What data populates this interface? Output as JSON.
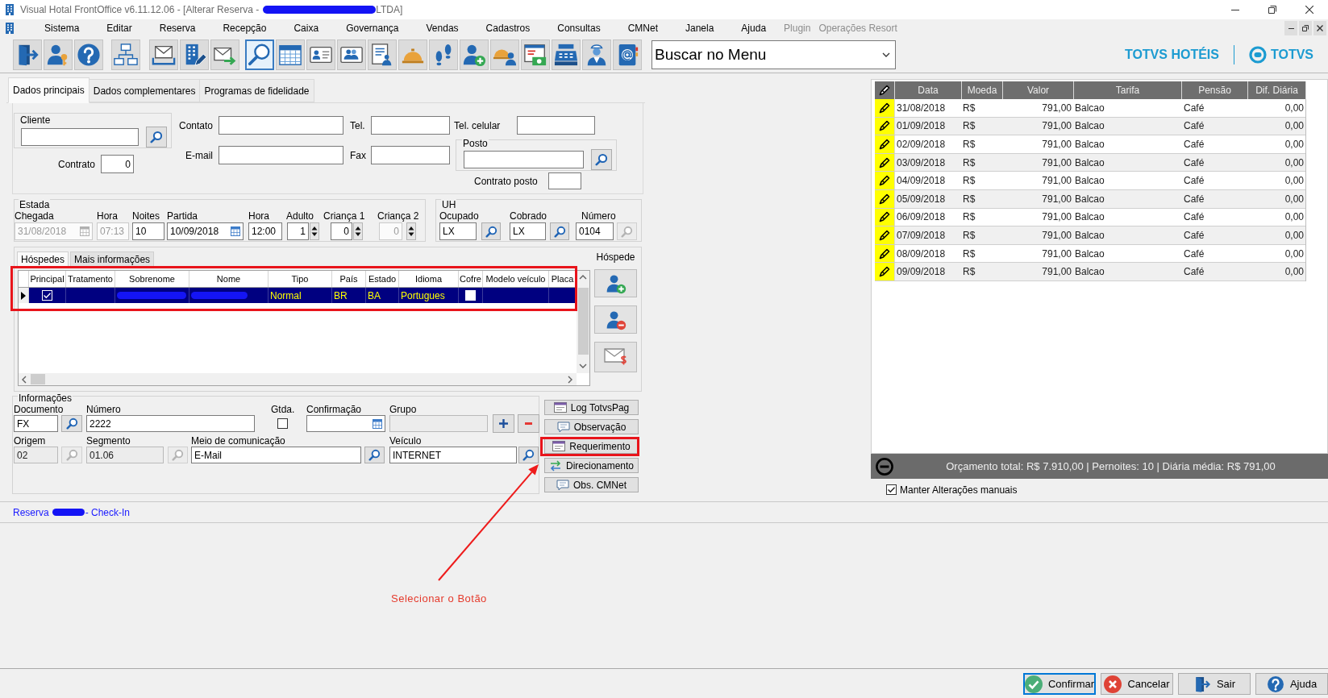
{
  "window": {
    "title_start": "Visual Hotal FrontOffice v6.11.12.06 - [Alterar Reserva -",
    "title_end": "LTDA]"
  },
  "menu": [
    {
      "label": "Sistema",
      "disabled": false
    },
    {
      "label": "Editar",
      "disabled": false
    },
    {
      "label": "Reserva",
      "disabled": false
    },
    {
      "label": "Recepção",
      "disabled": false
    },
    {
      "label": "Caixa",
      "disabled": false
    },
    {
      "label": "Governança",
      "disabled": false
    },
    {
      "label": "Vendas",
      "disabled": false
    },
    {
      "label": "Cadastros",
      "disabled": false
    },
    {
      "label": "Consultas",
      "disabled": false
    },
    {
      "label": "CMNet",
      "disabled": false
    },
    {
      "label": "Janela",
      "disabled": false
    },
    {
      "label": "Ajuda",
      "disabled": false
    },
    {
      "label": "Plugin",
      "disabled": true
    },
    {
      "label": "Operações Resort",
      "disabled": true
    }
  ],
  "toolbar": {
    "buttons": [
      {
        "selected": false
      },
      {
        "selected": false
      },
      {
        "selected": false
      },
      {
        "selected": false
      },
      {
        "selected": false
      },
      {
        "selected": false
      },
      {
        "selected": false
      },
      {
        "selected": true
      },
      {
        "selected": false
      },
      {
        "selected": false
      },
      {
        "selected": false
      },
      {
        "selected": false
      },
      {
        "selected": false
      },
      {
        "selected": false
      },
      {
        "selected": false
      },
      {
        "selected": false
      },
      {
        "selected": false
      },
      {
        "selected": false
      },
      {
        "selected": false
      },
      {
        "selected": false
      }
    ],
    "menu_search": {
      "value": "Buscar no Menu"
    },
    "brand": "TOTVS HOTÉIS",
    "logo_text": "TOTVS"
  },
  "tabs": [
    {
      "label": "Dados principais",
      "selected": true
    },
    {
      "label": "Dados complementares",
      "selected": false
    },
    {
      "label": "Programas de fidelidade",
      "selected": false
    }
  ],
  "client": {
    "legend": "Cliente"
  },
  "contract": {
    "label": "Contrato",
    "value": "0"
  },
  "contact_fields": [
    {
      "label": "Contato"
    },
    {
      "label": "E-mail"
    }
  ],
  "phone_fields": [
    {
      "label": "Tel."
    },
    {
      "label": "Fax"
    }
  ],
  "mobile": {
    "label": "Tel. celular"
  },
  "post": {
    "legend": "Posto"
  },
  "post_contract": {
    "label": "Contrato posto"
  },
  "stay": {
    "legend": "Estada",
    "fields": [
      {
        "label": "Chegada",
        "value": "31/08/2018",
        "kind": "date",
        "disabled": true
      },
      {
        "label": "Hora",
        "value": "07:13",
        "kind": "text",
        "disabled": true
      },
      {
        "label": "Noites",
        "value": "10",
        "kind": "text",
        "disabled": false
      },
      {
        "label": "Partida",
        "value": "10/09/2018",
        "kind": "date",
        "disabled": false
      },
      {
        "label": "Hora",
        "value": "12:00",
        "kind": "text",
        "disabled": false
      },
      {
        "label": "Adulto",
        "value": "1",
        "kind": "spin",
        "disabled": false
      },
      {
        "label": "Criança 1",
        "value": "0",
        "kind": "spin",
        "disabled": false
      },
      {
        "label": "Criança 2",
        "value": "0",
        "kind": "spin",
        "disabled": true
      }
    ]
  },
  "unit": {
    "legend": "UH",
    "fields": [
      {
        "label": "Ocupado",
        "value": "LX",
        "lookup_disabled": false
      },
      {
        "label": "Cobrado",
        "value": "LX",
        "lookup_disabled": false
      },
      {
        "label": "Número",
        "value": "0104",
        "lookup_disabled": true
      }
    ]
  },
  "guests": {
    "tabs": [
      {
        "label": "Hóspedes",
        "selected": true
      },
      {
        "label": "Mais informações",
        "selected": false
      }
    ],
    "side_label": "Hóspede",
    "highlighted": true,
    "columns": [
      "Principal",
      "Tratamento",
      "Sobrenome",
      "Nome",
      "Tipo",
      "País",
      "Estado",
      "Idioma",
      "Cofre",
      "Modelo veículo",
      "Placa"
    ],
    "rows": [
      {
        "selected": true,
        "principal": true,
        "type": "Normal",
        "country": "BR",
        "state": "BA",
        "language": "Portugues",
        "safe": false
      }
    ]
  },
  "info": {
    "legend": "Informações",
    "fields": [
      {
        "label": "Documento",
        "value": "FX",
        "kind": "lookup",
        "disabled": false
      },
      {
        "label": "Número",
        "value": "2222",
        "kind": "text",
        "disabled": false
      },
      {
        "label": "Gtda.",
        "kind": "checkbox",
        "checked": false
      },
      {
        "label": "Confirmação",
        "kind": "date",
        "disabled": false
      },
      {
        "label": "Grupo",
        "kind": "text",
        "disabled": true
      },
      {
        "label": "Origem",
        "value": "02",
        "kind": "lookup",
        "disabled": true
      },
      {
        "label": "Segmento",
        "value": "01.06",
        "kind": "lookup",
        "disabled": true
      },
      {
        "label": "Meio de comunicação",
        "value": "E-Mail",
        "kind": "lookup",
        "disabled": false
      },
      {
        "label": "Veículo",
        "value": "INTERNET",
        "kind": "lookup",
        "disabled": false
      }
    ]
  },
  "actions": [
    {
      "label": "Log TotvsPag",
      "highlighted": false
    },
    {
      "label": "Observação",
      "highlighted": false
    },
    {
      "label": "Requerimento",
      "highlighted": true
    },
    {
      "label": "Direcionamento",
      "highlighted": false
    },
    {
      "label": "Obs. CMNet",
      "highlighted": false
    }
  ],
  "status": {
    "start": "Reserva",
    "end": "- Check-In"
  },
  "rates": {
    "columns": [
      "Data",
      "Moeda",
      "Valor",
      "Tarifa",
      "Pensão",
      "Dif. Diária"
    ],
    "rows": [
      [
        "31/08/2018",
        "R$",
        "791,00",
        "Balcao",
        "Café",
        "0,00"
      ],
      [
        "01/09/2018",
        "R$",
        "791,00",
        "Balcao",
        "Café",
        "0,00"
      ],
      [
        "02/09/2018",
        "R$",
        "791,00",
        "Balcao",
        "Café",
        "0,00"
      ],
      [
        "03/09/2018",
        "R$",
        "791,00",
        "Balcao",
        "Café",
        "0,00"
      ],
      [
        "04/09/2018",
        "R$",
        "791,00",
        "Balcao",
        "Café",
        "0,00"
      ],
      [
        "05/09/2018",
        "R$",
        "791,00",
        "Balcao",
        "Café",
        "0,00"
      ],
      [
        "06/09/2018",
        "R$",
        "791,00",
        "Balcao",
        "Café",
        "0,00"
      ],
      [
        "07/09/2018",
        "R$",
        "791,00",
        "Balcao",
        "Café",
        "0,00"
      ],
      [
        "08/09/2018",
        "R$",
        "791,00",
        "Balcao",
        "Café",
        "0,00"
      ],
      [
        "09/09/2018",
        "R$",
        "791,00",
        "Balcao",
        "Café",
        "0,00"
      ]
    ]
  },
  "summary": "Orçamento total: R$ 7.910,00 | Pernoites: 10 | Diária média: R$ 791,00",
  "keep_manual": {
    "label": "Manter Alterações manuais",
    "checked": true
  },
  "footer_buttons": [
    {
      "label": "Confirmar",
      "focused": true
    },
    {
      "label": "Cancelar",
      "focused": false
    },
    {
      "label": "Sair",
      "focused": false
    },
    {
      "label": "Ajuda",
      "focused": false
    }
  ],
  "annotation": {
    "label": "Selecionar o Botão"
  }
}
